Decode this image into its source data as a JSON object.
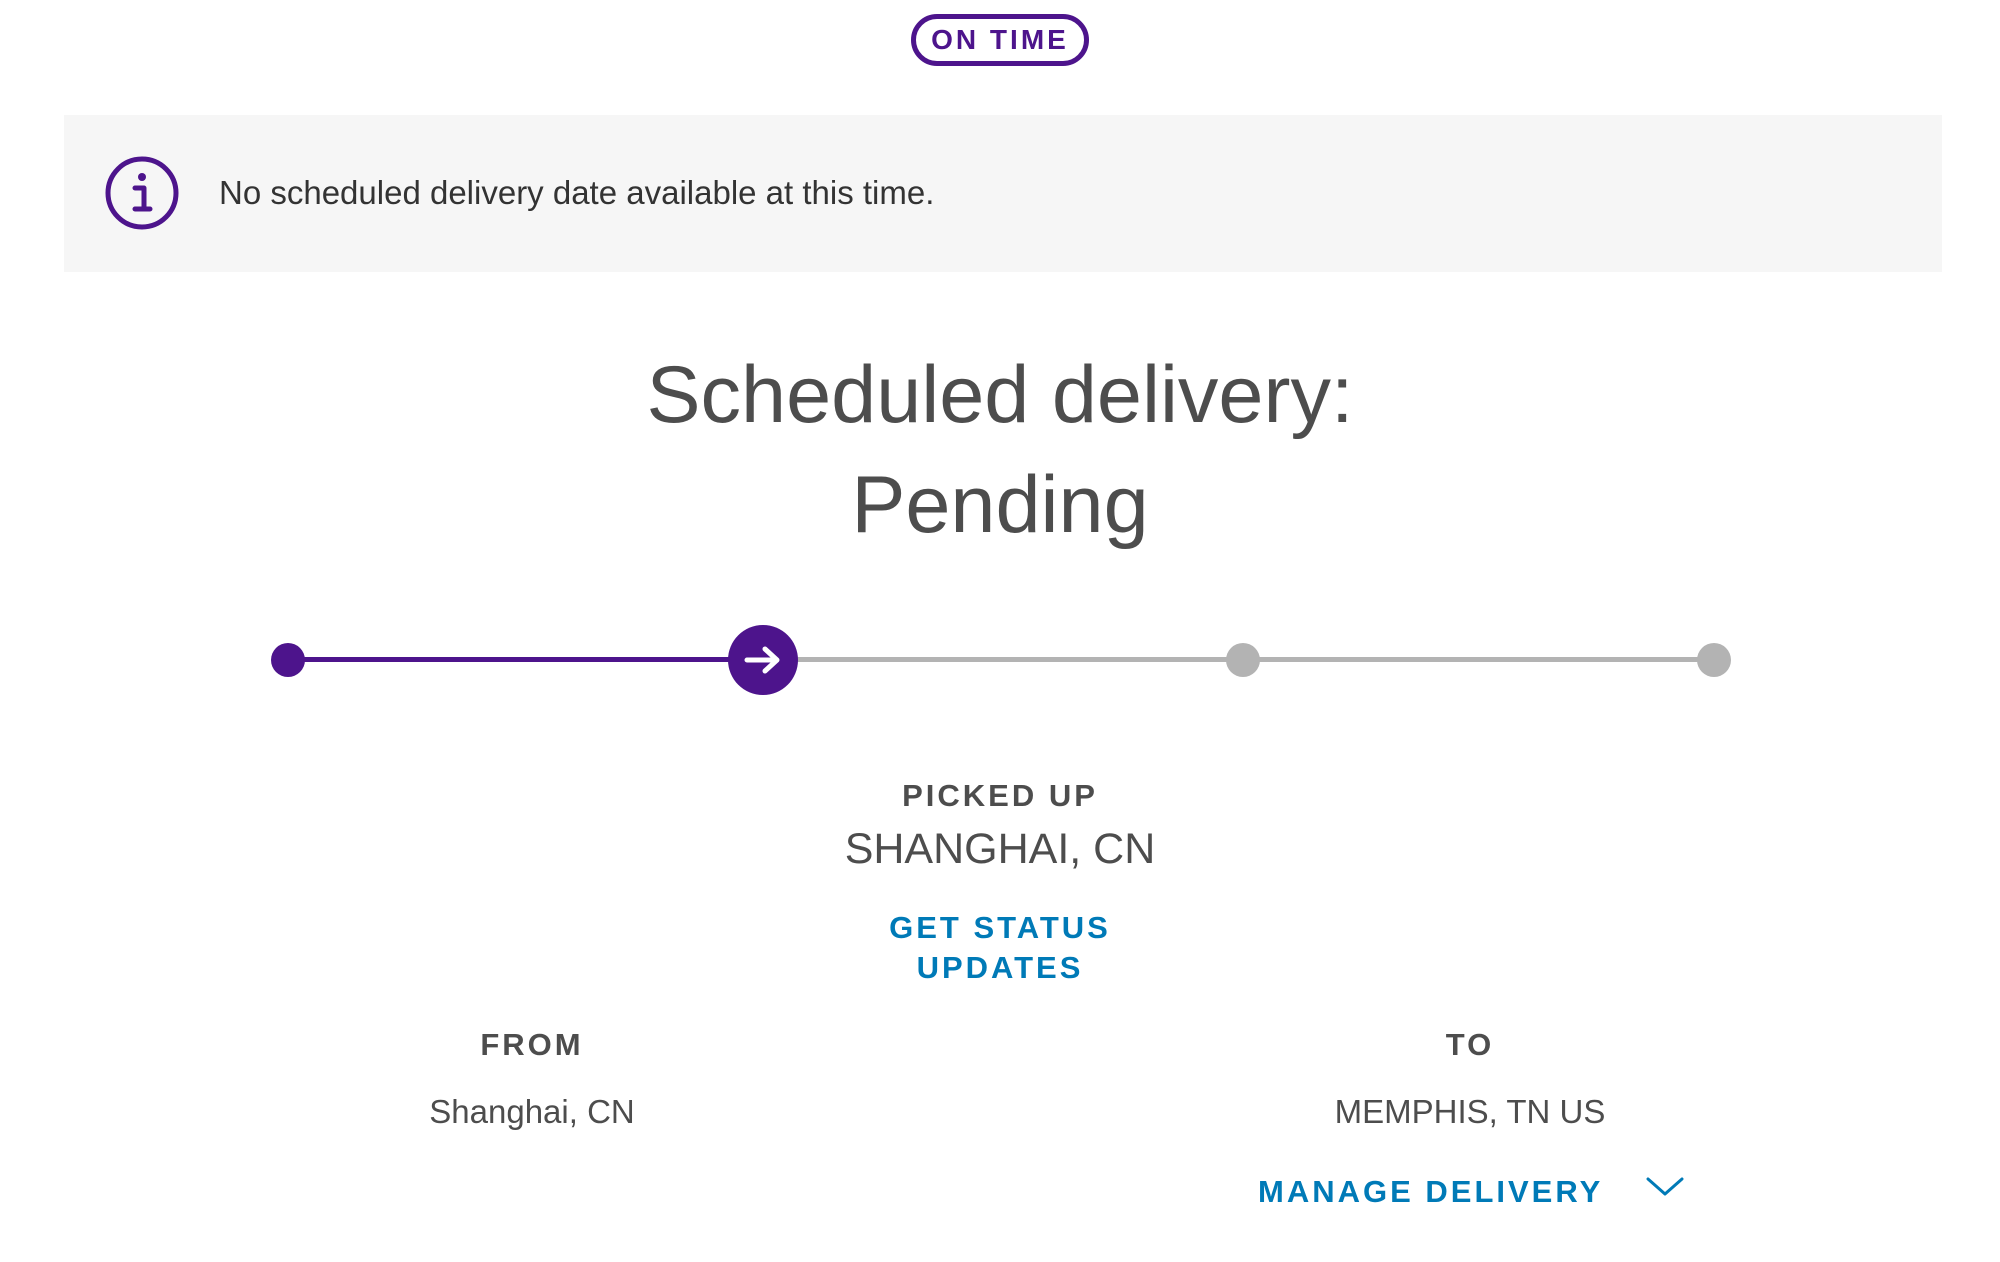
{
  "badge": {
    "label": "ON TIME"
  },
  "banner": {
    "message": "No scheduled delivery date available at this time."
  },
  "heading": {
    "line1": "Scheduled delivery:",
    "line2": "Pending"
  },
  "progress": {
    "steps_total": 4,
    "current_step": 2
  },
  "status": {
    "label": "PICKED UP",
    "location": "SHANGHAI, CN",
    "updates_link": "GET STATUS UPDATES"
  },
  "origin": {
    "label": "FROM",
    "value": "Shanghai, CN"
  },
  "destination": {
    "label": "TO",
    "value": "MEMPHIS, TN US",
    "manage_link": "MANAGE DELIVERY"
  },
  "icons": {
    "banner": "info-icon",
    "current_step": "arrow-right-icon",
    "manage": "chevron-down-icon"
  },
  "colors": {
    "brand_purple": "#4d148c",
    "link_blue": "#007ab7",
    "inactive_gray": "#b3b3b3",
    "banner_bg": "#f6f6f6",
    "text": "#4d4d4d"
  }
}
